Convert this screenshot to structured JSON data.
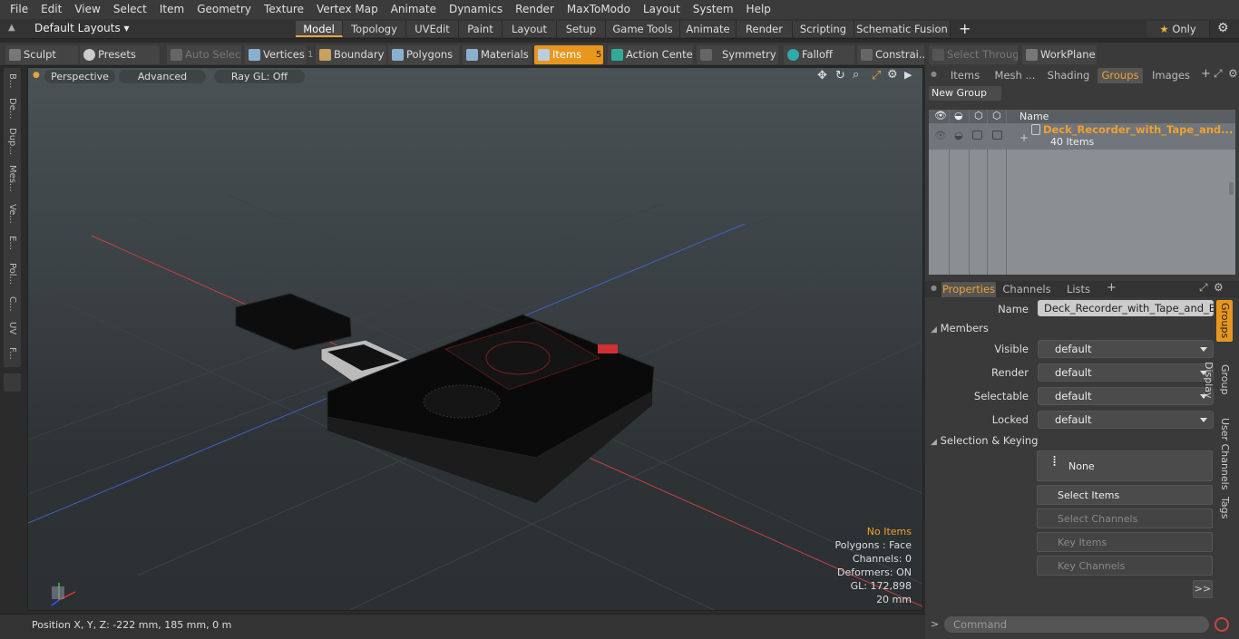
{
  "menu": [
    "File",
    "Edit",
    "View",
    "Select",
    "Item",
    "Geometry",
    "Texture",
    "Vertex Map",
    "Animate",
    "Dynamics",
    "Render",
    "MaxToModo",
    "Layout",
    "System",
    "Help"
  ],
  "layout": {
    "preset": "Default Layouts",
    "tabs": [
      "Model",
      "Topology",
      "UVEdit",
      "Paint",
      "Layout",
      "Setup",
      "Game Tools",
      "Animate",
      "Render",
      "Scripting",
      "Schematic Fusion"
    ],
    "active_tab": "Model",
    "only_label": "Only"
  },
  "toolbar": {
    "sculpt": "Sculpt",
    "presets": "Presets",
    "auto_select": "Auto Select",
    "vertices": "Vertices",
    "vertices_count": "1",
    "boundary": "Boundary",
    "polygons": "Polygons",
    "materials": "Materials",
    "items": "Items",
    "items_count": "5",
    "action_center": "Action Center",
    "symmetry": "Symmetry",
    "falloff": "Falloff",
    "constraints": "Constrai...",
    "select_through": "Select Through",
    "workplane": "WorkPlane"
  },
  "left_tabs": [
    "B...",
    "De...",
    "Dup...",
    "Mes...",
    "Ve...",
    "E...",
    "Pol...",
    "C...",
    "UV",
    "F..."
  ],
  "viewport": {
    "perspective": "Perspective",
    "advanced": "Advanced",
    "raygl": "Ray GL: Off",
    "info": {
      "no_items": "No Items",
      "polygons": "Polygons : Face",
      "channels": "Channels: 0",
      "deformers": "Deformers: ON",
      "gl": "GL: 172,898",
      "scale": "20 mm"
    }
  },
  "status": {
    "position": "Position X, Y, Z:   -222 mm, 185 mm, 0 m"
  },
  "right_panel": {
    "tabs": [
      "Items",
      "Mesh ...",
      "Shading",
      "Groups",
      "Images"
    ],
    "active_tab": "Groups",
    "new_group": "New Group",
    "col_name": "Name",
    "group_name": "Deck_Recorder_with_Tape_and...",
    "group_count": "40 Items",
    "prop_tabs": [
      "Properties",
      "Channels",
      "Lists"
    ],
    "prop_active": "Properties",
    "name_label": "Name",
    "name_value": "Deck_Recorder_with_Tape_and_Box_",
    "members_section": "Members",
    "visible_label": "Visible",
    "render_label": "Render",
    "selectable_label": "Selectable",
    "locked_label": "Locked",
    "default_value": "default",
    "sel_keying_section": "Selection & Keying",
    "none_label": "None",
    "select_items": "Select Items",
    "select_channels": "Select Channels",
    "key_items": "Key Items",
    "key_channels": "Key Channels",
    "more": ">>",
    "side_tabs": [
      "Groups",
      "Group Display",
      "User Channels",
      "Tags"
    ],
    "command_placeholder": "Command"
  }
}
